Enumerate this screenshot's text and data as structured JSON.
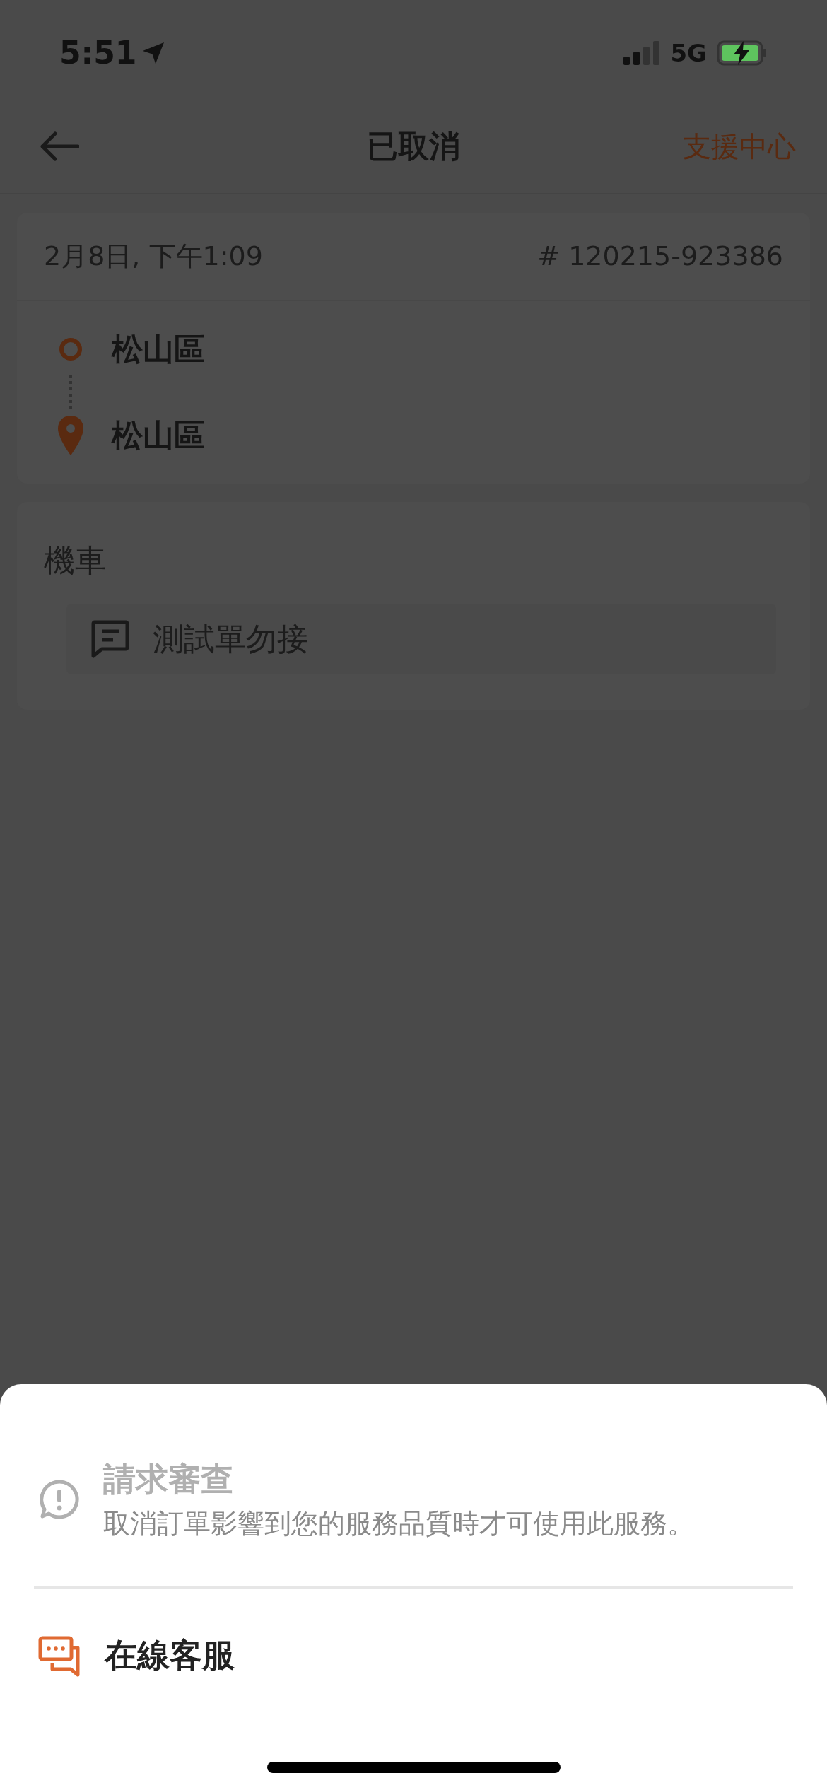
{
  "status_bar": {
    "time": "5:51",
    "network": "5G"
  },
  "nav": {
    "title": "已取消",
    "action": "支援中心"
  },
  "order": {
    "date": "2月8日, 下午1:09",
    "number": "# 120215-923386",
    "stops": [
      {
        "kind": "pickup",
        "name": "松山區"
      },
      {
        "kind": "dropoff",
        "name": "松山區"
      }
    ]
  },
  "vehicle": {
    "type": "機車",
    "note": "測試單勿接"
  },
  "sheet": {
    "options": [
      {
        "kind": "review",
        "title": "請求審查",
        "description": "取消訂單影響到您的服務品質時才可使用此服務。",
        "disabled": true
      },
      {
        "kind": "chat",
        "title": "在線客服",
        "disabled": false
      }
    ]
  }
}
